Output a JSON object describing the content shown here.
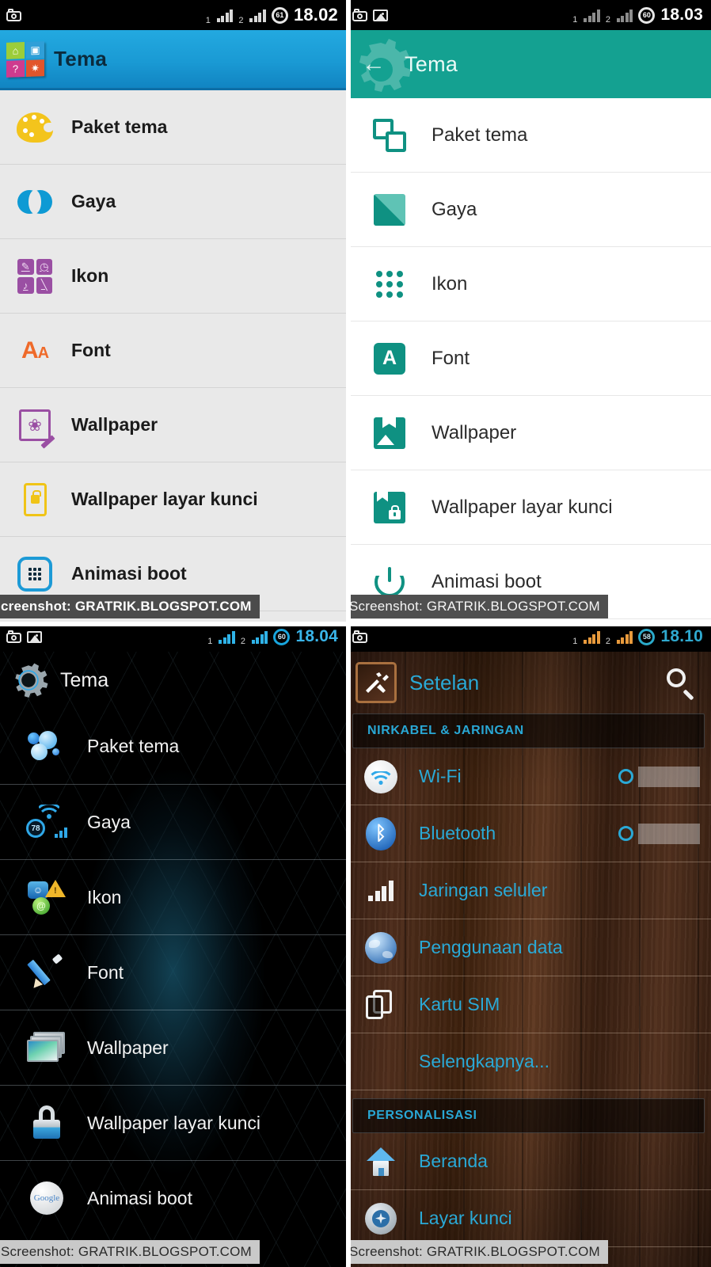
{
  "watermark": {
    "full": "Screenshot: GRATRIK.BLOGSPOT.COM",
    "clipped": "creenshot: GRATRIK.BLOGSPOT.COM"
  },
  "panels": {
    "theme_light_blue": {
      "status_bar": {
        "time": "18.02",
        "battery": "61",
        "sim1": "1",
        "sim2": "2"
      },
      "title": "Tema",
      "items": [
        {
          "label": "Paket tema",
          "icon": "palette-icon"
        },
        {
          "label": "Gaya",
          "icon": "venn-circles-icon"
        },
        {
          "label": "Ikon",
          "icon": "icon-grid-icon"
        },
        {
          "label": "Font",
          "icon": "font-aa-icon"
        },
        {
          "label": "Wallpaper",
          "icon": "wallpaper-edit-icon"
        },
        {
          "label": "Wallpaper layar kunci",
          "icon": "lockscreen-wallpaper-icon"
        },
        {
          "label": "Animasi boot",
          "icon": "boot-animation-icon"
        }
      ]
    },
    "theme_teal": {
      "status_bar": {
        "time": "18.03",
        "battery": "60",
        "sim1": "1",
        "sim2": "2"
      },
      "title": "Tema",
      "back_glyph": "←",
      "items": [
        {
          "label": "Paket tema",
          "icon": "copy-squares-icon"
        },
        {
          "label": "Gaya",
          "icon": "diagonal-square-icon"
        },
        {
          "label": "Ikon",
          "icon": "nine-dots-icon"
        },
        {
          "label": "Font",
          "icon": "font-a-square-icon"
        },
        {
          "label": "Wallpaper",
          "icon": "image-bookmark-icon"
        },
        {
          "label": "Wallpaper layar kunci",
          "icon": "image-lock-icon"
        },
        {
          "label": "Animasi boot",
          "icon": "power-icon"
        }
      ]
    },
    "theme_dark": {
      "status_bar": {
        "time": "18.04",
        "battery": "60",
        "sim1": "1",
        "sim2": "2"
      },
      "title": "Tema",
      "items": [
        {
          "label": "Paket tema",
          "icon": "blue-bubbles-icon"
        },
        {
          "label": "Gaya",
          "icon": "wifi-signal-icon",
          "badge": "78"
        },
        {
          "label": "Ikon",
          "icon": "mixed-icons-icon"
        },
        {
          "label": "Font",
          "icon": "pencil-icon"
        },
        {
          "label": "Wallpaper",
          "icon": "wallpaper-stack-icon"
        },
        {
          "label": "Wallpaper layar kunci",
          "icon": "padlock-icon"
        },
        {
          "label": "Animasi boot",
          "icon": "google-circle-icon"
        }
      ]
    },
    "settings_wood": {
      "status_bar": {
        "time": "18.10",
        "battery": "58",
        "sim1": "1",
        "sim2": "2"
      },
      "title": "Setelan",
      "title_icon": "tools-icon",
      "search_icon": "search-icon",
      "sections": [
        {
          "header": "NIRKABEL & JARINGAN",
          "items": [
            {
              "label": "Wi-Fi",
              "icon": "wifi-icon",
              "toggle": true
            },
            {
              "label": "Bluetooth",
              "icon": "bluetooth-icon",
              "toggle": true
            },
            {
              "label": "Jaringan seluler",
              "icon": "signal-bars-icon"
            },
            {
              "label": "Penggunaan data",
              "icon": "globe-icon"
            },
            {
              "label": "Kartu SIM",
              "icon": "sim-card-icon"
            },
            {
              "label": "Selengkapnya...",
              "icon": null
            }
          ]
        },
        {
          "header": "PERSONALISASI",
          "items": [
            {
              "label": "Beranda",
              "icon": "home-icon"
            },
            {
              "label": "Layar kunci",
              "icon": "compass-icon"
            }
          ]
        }
      ]
    }
  }
}
